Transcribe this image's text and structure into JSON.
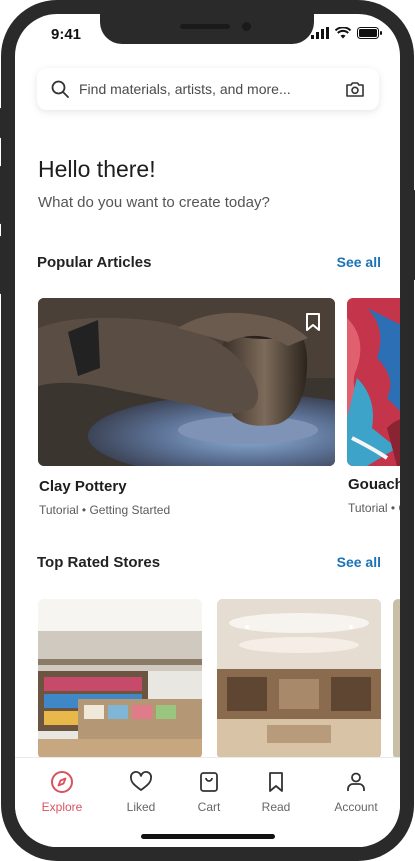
{
  "status": {
    "time": "9:41"
  },
  "search": {
    "placeholder": "Find materials, artists, and more..."
  },
  "greeting": {
    "title": "Hello there!",
    "subtitle": "What do you want to create today?"
  },
  "articles": {
    "title": "Popular Articles",
    "see_all": "See all",
    "items": [
      {
        "title": "Clay Pottery",
        "subtitle": "Tutorial • Getting Started"
      },
      {
        "title": "Gouache",
        "subtitle": "Tutorial • Getting Started"
      }
    ]
  },
  "stores": {
    "title": "Top Rated Stores",
    "see_all": "See all"
  },
  "nav": {
    "items": [
      {
        "label": "Explore",
        "icon": "compass-icon",
        "active": true
      },
      {
        "label": "Liked",
        "icon": "heart-icon",
        "active": false
      },
      {
        "label": "Cart",
        "icon": "bag-icon",
        "active": false
      },
      {
        "label": "Read",
        "icon": "bookmark-icon",
        "active": false
      },
      {
        "label": "Account",
        "icon": "person-icon",
        "active": false
      }
    ]
  },
  "colors": {
    "accent": "#d9535f",
    "link": "#1a73b8",
    "frame": "#2a2a2a"
  }
}
